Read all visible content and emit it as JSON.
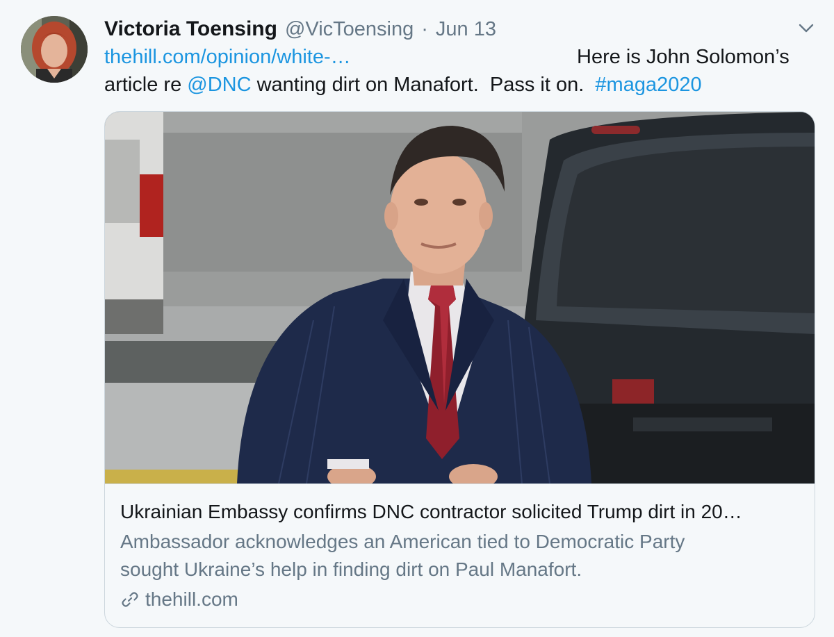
{
  "tweet": {
    "display_name": "Victoria Toensing",
    "handle": "@VicToensing",
    "separator": "·",
    "date": "Jun 13",
    "text": {
      "url": "thehill.com/opinion/white-…",
      "line1_after_url": "Here is John Solomon’s",
      "line2_before_mention": "article re ",
      "mention": "@DNC",
      "line2_middle": " wanting dirt on Manafort.  Pass it on.  ",
      "hashtag": "#maga2020"
    }
  },
  "card": {
    "title": "Ukrainian Embassy confirms DNC contractor solicited Trump dirt in 20…",
    "description_line1": "Ambassador acknowledges an American tied to Democratic Party",
    "description_line2": "sought Ukraine’s help in finding dirt on Paul Manafort.",
    "source": "thehill.com"
  },
  "icons": {
    "menu": "chevron-down-icon",
    "card_link": "link-icon"
  },
  "colors": {
    "link": "#1b95e0",
    "secondary_text": "#657786",
    "primary_text": "#14171a",
    "background": "#f5f8fa",
    "border": "#ccd6dd"
  }
}
